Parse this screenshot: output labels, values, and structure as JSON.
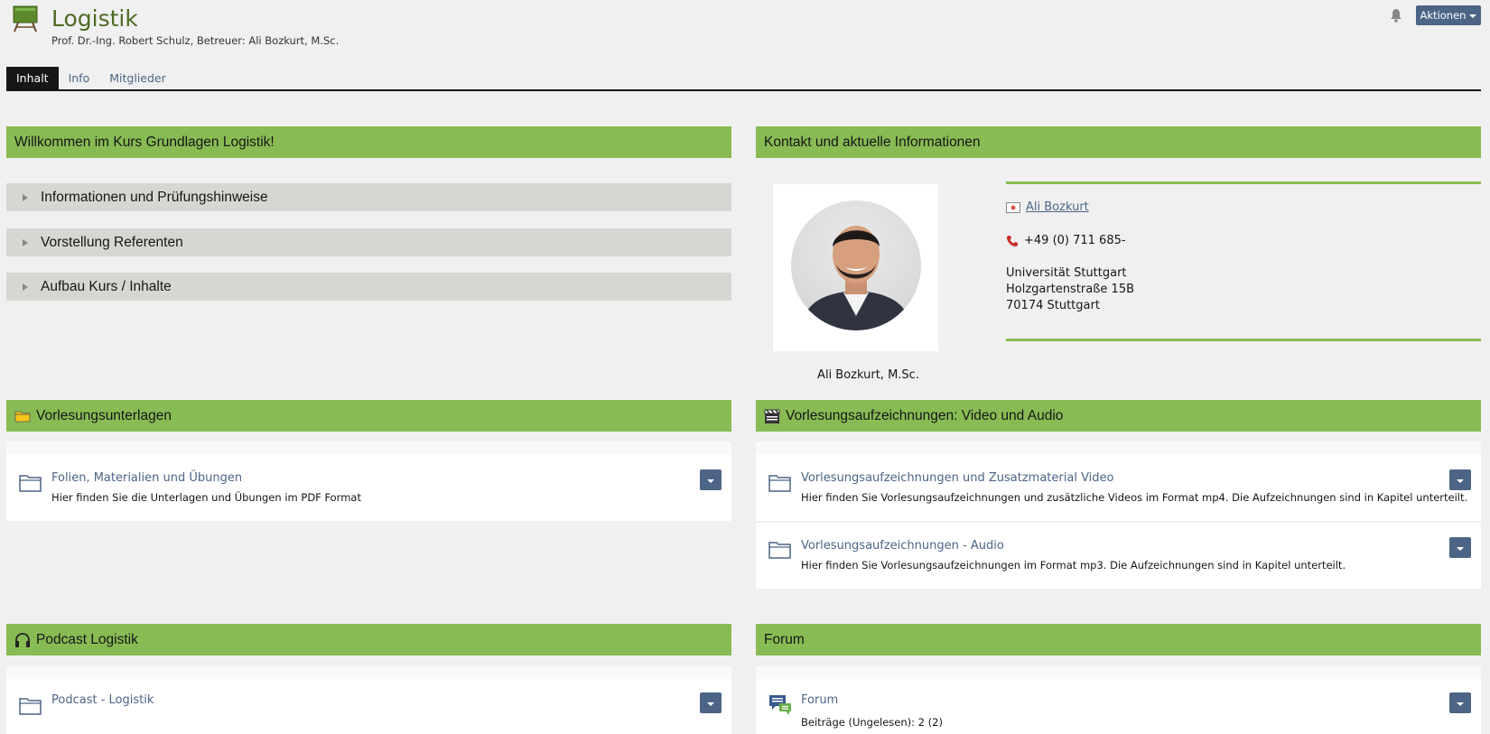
{
  "header": {
    "title": "Logistik",
    "subtitle": "Prof. Dr.-Ing. Robert Schulz, Betreuer: Ali Bozkurt, M.Sc.",
    "actions_label": "Aktionen",
    "course_icon": "course-board-icon",
    "notification_icon": "bell-icon"
  },
  "tabs": [
    {
      "label": "Inhalt",
      "active": true
    },
    {
      "label": "Info",
      "active": false
    },
    {
      "label": "Mitglieder",
      "active": false
    }
  ],
  "welcome": {
    "title": "Willkommen im Kurs Grundlagen Logistik!",
    "accordions": [
      "Informationen und Prüfungshinweise",
      "Vorstellung Referenten",
      "Aufbau Kurs / Inhalte"
    ]
  },
  "contact": {
    "title": "Kontakt und aktuelle Informationen",
    "photo_caption": "Ali Bozkurt, M.Sc.",
    "name_link": "Ali Bozkurt",
    "phone": "+49 (0) 711 685-",
    "address_line1": "Universität Stuttgart",
    "address_line2": "Holzgartenstraße 15B",
    "address_line3": "70174 Stuttgart"
  },
  "lectures": {
    "title": "Vorlesungsunterlagen",
    "icon": "folder-icon",
    "items": [
      {
        "title": "Folien, Materialien und Übungen",
        "desc": "Hier finden Sie die Unterlagen und Übungen im PDF Format"
      }
    ]
  },
  "recordings": {
    "title": "Vorlesungsaufzeichnungen: Video und Audio",
    "icon": "clapperboard-icon",
    "items": [
      {
        "title": "Vorlesungsaufzeichnungen und Zusatzmaterial Video",
        "desc": "Hier finden Sie Vorlesungsaufzeichnungen und zusätzliche Videos im Format mp4. Die Aufzeichnungen sind in Kapitel unterteilt."
      },
      {
        "title": "Vorlesungsaufzeichnungen - Audio",
        "desc": "Hier finden Sie Vorlesungsaufzeichnungen im Format mp3. Die Aufzeichnungen sind in Kapitel unterteilt."
      }
    ]
  },
  "podcast": {
    "title": "Podcast Logistik",
    "icon": "headphones-icon",
    "items": [
      {
        "title": "Podcast - Logistik"
      }
    ]
  },
  "forum": {
    "title": "Forum",
    "items": [
      {
        "title": "Forum",
        "desc": "Beiträge (Ungelesen): 2 (2)"
      }
    ]
  },
  "colors": {
    "accent_green": "#89bb54",
    "title_green": "#4e6a24",
    "link_blue": "#4c6586",
    "accordion_grey": "#d5d8d2",
    "background": "#f0f0f0"
  }
}
